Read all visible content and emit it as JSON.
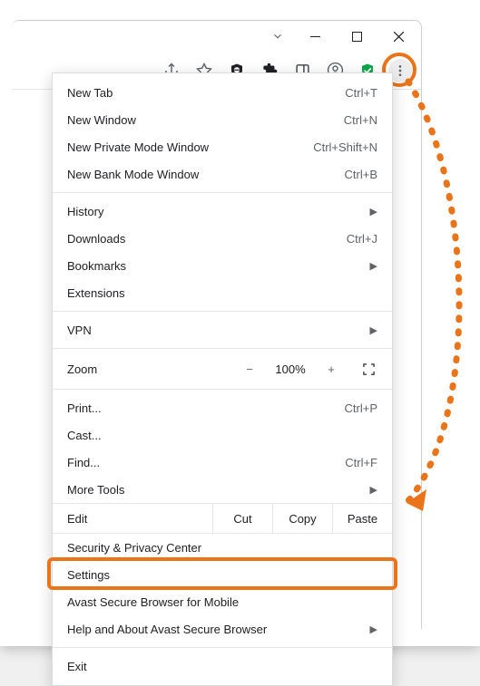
{
  "window": {
    "chev": "⌄"
  },
  "toolbar": {
    "share": "share-icon",
    "star": "star-icon",
    "shield": "shield-icon",
    "ext": "extensions-icon",
    "panel": "sidepanel-icon",
    "profile": "profile-icon",
    "security": "security-shield-icon",
    "more": "more-icon"
  },
  "menu": {
    "new_tab": {
      "label": "New Tab",
      "shortcut": "Ctrl+T"
    },
    "new_window": {
      "label": "New Window",
      "shortcut": "Ctrl+N"
    },
    "new_private": {
      "label": "New Private Mode Window",
      "shortcut": "Ctrl+Shift+N"
    },
    "new_bank": {
      "label": "New Bank Mode Window",
      "shortcut": "Ctrl+B"
    },
    "history": {
      "label": "History"
    },
    "downloads": {
      "label": "Downloads",
      "shortcut": "Ctrl+J"
    },
    "bookmarks": {
      "label": "Bookmarks"
    },
    "extensions": {
      "label": "Extensions"
    },
    "vpn": {
      "label": "VPN"
    },
    "zoom": {
      "label": "Zoom",
      "value": "100%",
      "minus": "−",
      "plus": "+"
    },
    "print": {
      "label": "Print...",
      "shortcut": "Ctrl+P"
    },
    "cast": {
      "label": "Cast..."
    },
    "find": {
      "label": "Find...",
      "shortcut": "Ctrl+F"
    },
    "more_tools": {
      "label": "More Tools"
    },
    "edit": {
      "label": "Edit",
      "cut": "Cut",
      "copy": "Copy",
      "paste": "Paste"
    },
    "security_center": {
      "label": "Security & Privacy Center"
    },
    "settings": {
      "label": "Settings"
    },
    "mobile": {
      "label": "Avast Secure Browser for Mobile"
    },
    "help": {
      "label": "Help and About Avast Secure Browser"
    },
    "exit": {
      "label": "Exit"
    }
  },
  "colors": {
    "highlight": "#e9741a",
    "security_green": "#0aa74b"
  }
}
